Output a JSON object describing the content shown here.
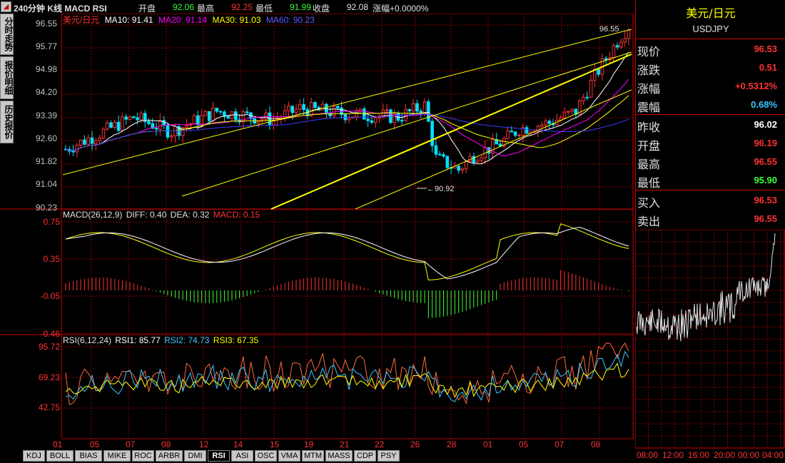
{
  "header": {
    "title": "240分钟 K线 MACD RSI",
    "open_label": "开盘",
    "open_value": "92.06",
    "high_label": "最高",
    "high_value": "92.25",
    "low_label": "最低",
    "low_value": "91.99",
    "close_label": "收盘",
    "close_value": "92.08",
    "change_text": "涨幅+0.0000%"
  },
  "side_tabs": [
    "分时走势",
    "报价明细",
    "历史报价"
  ],
  "price_panel": {
    "legend": {
      "name": "美元/日元",
      "ma10": "MA10: 91.41",
      "ma20": "MA20: 91.14",
      "ma30": "MA30: 91.03",
      "ma60": "MA60: 90.23"
    },
    "y_ticks": [
      "96.55",
      "95.77",
      "94.98",
      "94.20",
      "93.39",
      "92.60",
      "91.82",
      "91.04",
      "90.23"
    ],
    "annotations": {
      "high_label": "96.55",
      "low_label": "90.92"
    }
  },
  "macd_panel": {
    "legend_name": "MACD(26,12,9)",
    "diff": "DIFF: 0.40",
    "dea": "DEA: 0.32",
    "macd": "MACD: 0.15",
    "y_ticks": [
      "0.75",
      "0.35",
      "-0.05",
      "-0.46"
    ]
  },
  "rsi_panel": {
    "legend_name": "RSI(6,12,24)",
    "rsi1": "RSI1: 85.77",
    "rsi2": "RSI2: 74.73",
    "rsi3": "RSI3: 67.35",
    "y_ticks": [
      "95.72",
      "69.23",
      "42.75"
    ]
  },
  "x_ticks": [
    "01",
    "05",
    "07",
    "08",
    "12",
    "14",
    "15",
    "19",
    "21",
    "22",
    "26",
    "28",
    "01",
    "05",
    "07",
    "08"
  ],
  "quote": {
    "name": "美元/日元",
    "symbol": "USDJPY",
    "rows": [
      {
        "label": "现价",
        "value": "96.53",
        "color": "#ff3232"
      },
      {
        "label": "涨跌",
        "value": "0.51",
        "color": "#ff3232"
      },
      {
        "label": "涨幅",
        "value": "+0.5312%",
        "color": "#ff3232"
      },
      {
        "label": "震幅",
        "value": "0.68%",
        "color": "#39c8ff"
      },
      {
        "label": "昨收",
        "value": "96.02",
        "color": "#ffffff"
      },
      {
        "label": "开盘",
        "value": "96.19",
        "color": "#ff3232"
      },
      {
        "label": "最高",
        "value": "96.55",
        "color": "#ff3232"
      },
      {
        "label": "最低",
        "value": "95.90",
        "color": "#39ff39"
      },
      {
        "label": "买入",
        "value": "96.53",
        "color": "#ff3232"
      },
      {
        "label": "卖出",
        "value": "96.55",
        "color": "#ff3232"
      }
    ]
  },
  "mini_chart": {
    "time_labels": [
      "08:00",
      "12:00",
      "16:00",
      "20:00",
      "00:00",
      "04:00"
    ]
  },
  "bottom_tabs": [
    "KDJ",
    "BOLL",
    "BIAS",
    "MIKE",
    "ROC",
    "ARBR",
    "DMI",
    "RSI",
    "ASI",
    "OSC",
    "VMA",
    "MTM",
    "MASS",
    "CDP",
    "PSY"
  ],
  "active_tab": "RSI",
  "colors": {
    "up": "#ff3232",
    "down": "#00e0ff",
    "grid": "#8b0000",
    "ma10": "#ffffff",
    "ma20": "#ffff00",
    "ma30": "#ff00ff",
    "ma60": "#3c3cff"
  }
}
